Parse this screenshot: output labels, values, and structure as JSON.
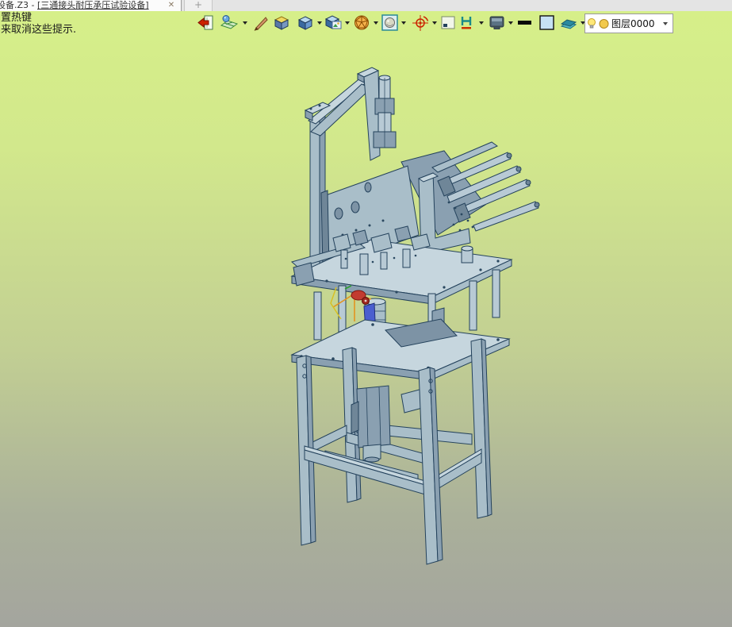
{
  "tab_bar": {
    "active_tab": {
      "title_file": "设备.Z3 - ",
      "title_doc": "[三通接头耐压承压试验设备]",
      "close_label": "✕"
    },
    "new_tab_label": "+"
  },
  "hint": {
    "line1": "置热键",
    "line2": "来取消这些提示."
  },
  "toolbar": {
    "icons": [
      {
        "name": "exit-icon",
        "dropdown": false
      },
      {
        "name": "render-mode-icon",
        "dropdown": true
      },
      {
        "name": "brush-icon",
        "dropdown": false
      },
      {
        "name": "shaded-box-icon",
        "dropdown": false
      },
      {
        "name": "cube-icon",
        "dropdown": true
      },
      {
        "name": "textured-cube-icon",
        "dropdown": true
      },
      {
        "name": "wireframe-sphere-icon",
        "dropdown": true
      },
      {
        "name": "sphere-preview-icon",
        "dropdown": true
      },
      {
        "name": "rotate-target-icon",
        "dropdown": true
      },
      {
        "name": "corner-box-icon",
        "dropdown": false
      },
      {
        "name": "text-height-icon",
        "dropdown": true
      },
      {
        "name": "monitor-icon",
        "dropdown": true
      },
      {
        "name": "line-width-icon",
        "dropdown": false
      },
      {
        "name": "color-swatch-icon",
        "dropdown": false
      },
      {
        "name": "layers-icon",
        "dropdown": true
      }
    ],
    "layer_selector": {
      "value": "图层0000",
      "icons": [
        "bulb-icon",
        "layer-color-icon"
      ]
    }
  },
  "viewport": {
    "model_name": "三通接头耐压承压试验设备",
    "colors": {
      "bg_top": "#d6ef89",
      "bg_bottom": "#a4a59e",
      "body": "#a9bec9",
      "body_light": "#c6d6de",
      "body_dark": "#8aa0b1",
      "edge": "#24425c",
      "accent_red": "#c23b30",
      "accent_orange": "#e39420",
      "accent_blue": "#4a5ecf"
    }
  }
}
